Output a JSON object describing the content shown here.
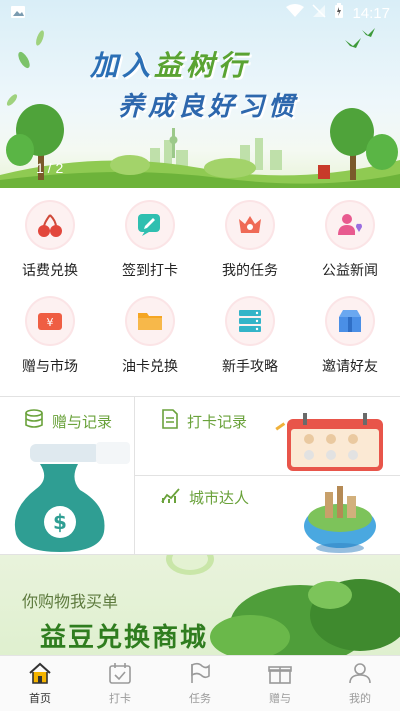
{
  "status_bar": {
    "time": "14:17"
  },
  "banner": {
    "title_line1_a": "加入",
    "title_line1_b": "益树行",
    "title_line2": "养成良好习惯",
    "indicator": "1 / 2"
  },
  "menu": [
    {
      "label": "话费兑换",
      "icon": "cherry-icon"
    },
    {
      "label": "签到打卡",
      "icon": "edit-message-icon"
    },
    {
      "label": "我的任务",
      "icon": "crown-icon"
    },
    {
      "label": "公益新闻",
      "icon": "people-heart-icon"
    },
    {
      "label": "赠与市场",
      "icon": "yen-ticket-icon"
    },
    {
      "label": "油卡兑换",
      "icon": "folder-icon"
    },
    {
      "label": "新手攻略",
      "icon": "server-list-icon"
    },
    {
      "label": "邀请好友",
      "icon": "gift-box-icon"
    }
  ],
  "cards": {
    "gift_records": "赠与记录",
    "checkin_records": "打卡记录",
    "city_expert": "城市达人"
  },
  "promo": {
    "subtitle": "你购物我买单",
    "title": "益豆兑换商城"
  },
  "bottom_nav": [
    {
      "label": "首页",
      "active": true
    },
    {
      "label": "打卡",
      "active": false
    },
    {
      "label": "任务",
      "active": false
    },
    {
      "label": "赠与",
      "active": false
    },
    {
      "label": "我的",
      "active": false
    }
  ],
  "colors": {
    "card_title": "#6aa23b",
    "active_nav": "#f4b400"
  }
}
